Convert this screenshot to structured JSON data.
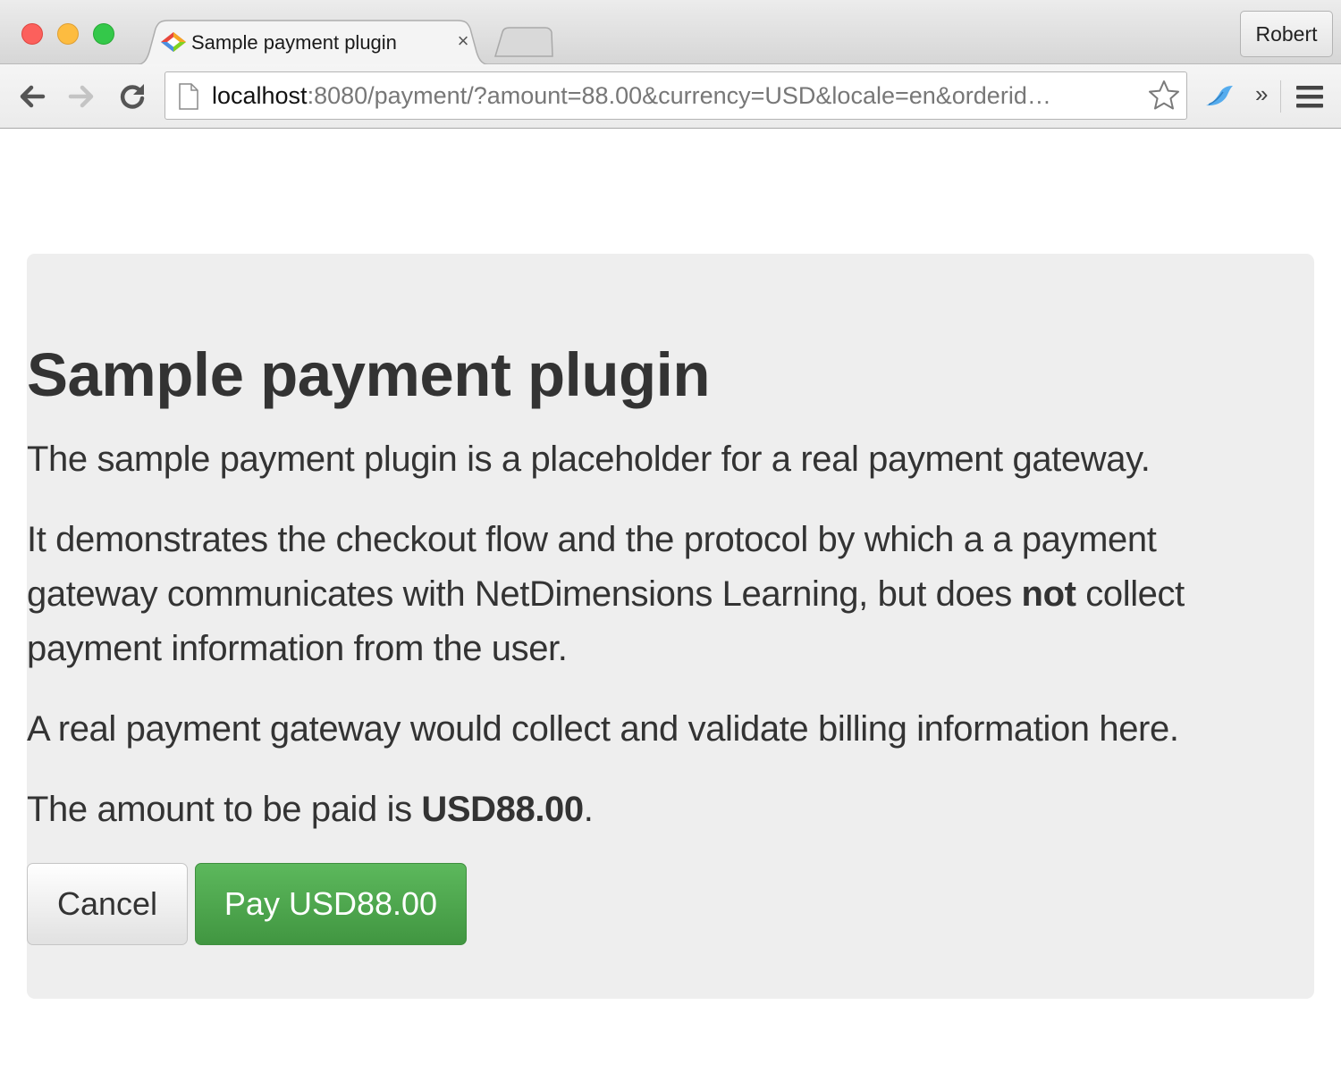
{
  "browser": {
    "tab": {
      "title": "Sample payment plugin",
      "close_symbol": "×"
    },
    "profile_name": "Robert",
    "address_bar": {
      "host": "localhost",
      "rest": ":8080/payment/?amount=88.00&currency=USD&locale=en&orderid…"
    },
    "overflow_symbol": "»",
    "icons": {
      "back": "arrow-left-icon",
      "forward": "arrow-right-icon",
      "reload": "reload-icon",
      "page": "page-icon",
      "bookmark": "star-icon",
      "extension": "bird-extension-icon",
      "menu": "hamburger-menu-icon"
    }
  },
  "page": {
    "heading": "Sample payment plugin",
    "intro": "The sample payment plugin is a placeholder for a real payment gateway.",
    "demo_text_before": "It demonstrates the checkout flow and the protocol by which a a payment gateway communicates with NetDimensions Learning, but does ",
    "demo_text_bold": "not",
    "demo_text_after": " collect payment information from the user.",
    "real_gateway_text": "A real payment gateway would collect and validate billing information here.",
    "amount_text_before": "The amount to be paid is ",
    "amount_value": "USD88.00",
    "amount_text_after": ".",
    "cancel_label": "Cancel",
    "pay_label": "Pay USD88.00"
  },
  "colors": {
    "pay_button": "#4cae4c",
    "jumbotron_bg": "#eeeeee",
    "text": "#333333"
  }
}
